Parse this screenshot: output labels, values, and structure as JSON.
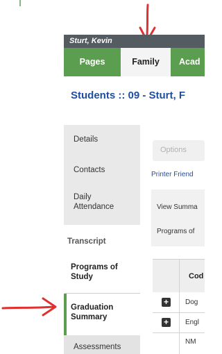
{
  "window": {
    "user_name": "Sturt, Kevin"
  },
  "nav": {
    "tabs": [
      "Pages",
      "Family",
      "Acad"
    ]
  },
  "page": {
    "title": "Students :: 09 - Sturt, F"
  },
  "sidebar": {
    "items": [
      {
        "label": "Details"
      },
      {
        "label": "Contacts"
      },
      {
        "label": "Daily Attendance"
      },
      {
        "label": "Transcript"
      },
      {
        "label": "Programs of Study"
      },
      {
        "label": "Graduation Summary"
      },
      {
        "label": "Assessments"
      }
    ]
  },
  "main": {
    "options_label": "Options",
    "printer_link": "Printer Friend",
    "panel": {
      "line1": "View Summa",
      "line2": "Programs of"
    },
    "table": {
      "header": "Cod",
      "rows": [
        {
          "code": "Dog",
          "expand": "+"
        },
        {
          "code": "Engl",
          "expand": "+"
        },
        {
          "code": "NM"
        }
      ]
    }
  },
  "colors": {
    "nav_green": "#5c9e4f",
    "title_blue": "#1f4ea0",
    "arrow_red": "#e03030",
    "header_gray": "#555c61"
  }
}
